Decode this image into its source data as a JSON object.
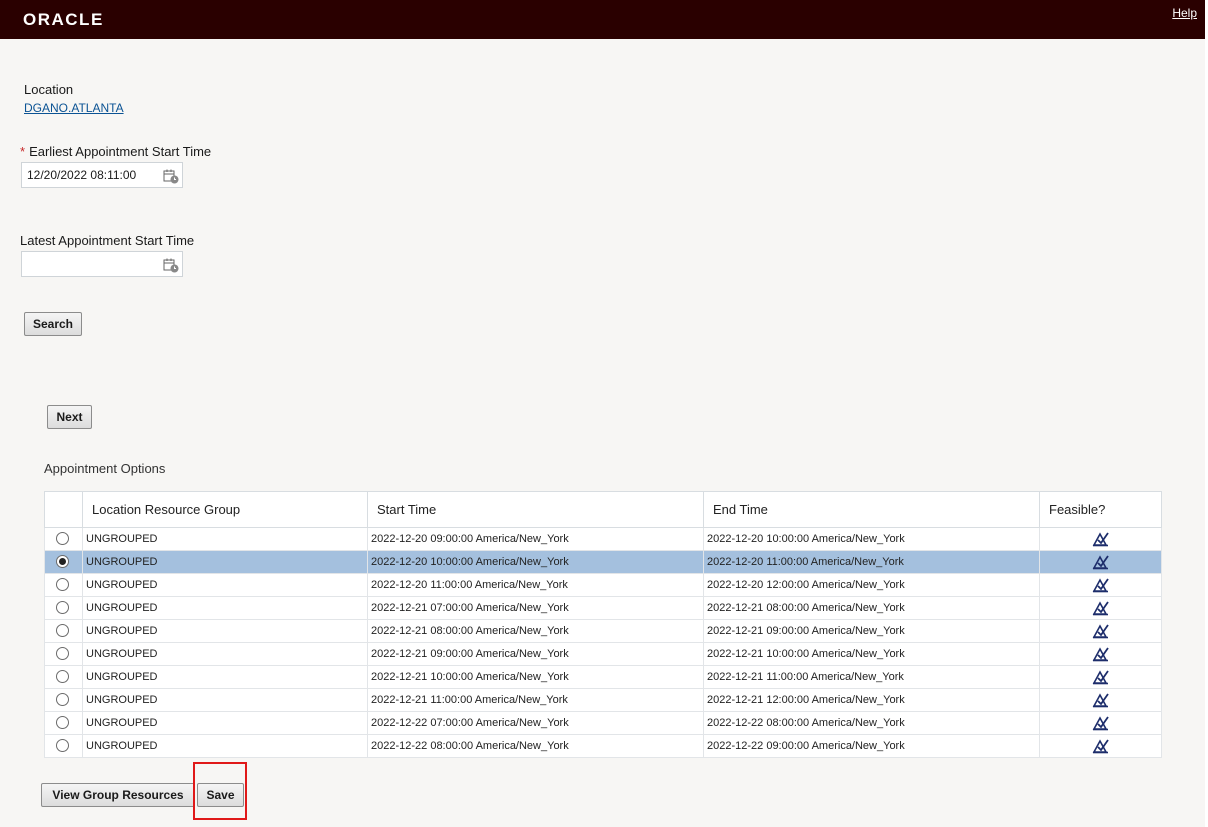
{
  "header": {
    "logo": "ORACLE",
    "help": "Help"
  },
  "form": {
    "location_label": "Location",
    "location_value": "DGANO.ATLANTA",
    "earliest_label": "Earliest Appointment Start Time",
    "earliest_required": "*",
    "earliest_value": "12/20/2022 08:11:00",
    "latest_label": "Latest Appointment Start Time",
    "latest_value": ""
  },
  "buttons": {
    "search": "Search",
    "next": "Next",
    "view_group_resources": "View Group Resources",
    "save": "Save"
  },
  "table": {
    "title": "Appointment Options",
    "columns": [
      "",
      "Location Resource Group",
      "Start Time",
      "End Time",
      "Feasible?"
    ],
    "rows": [
      {
        "group": "UNGROUPED",
        "start": "2022-12-20 09:00:00 America/New_York",
        "end": "2022-12-20 10:00:00 America/New_York",
        "selected": false
      },
      {
        "group": "UNGROUPED",
        "start": "2022-12-20 10:00:00 America/New_York",
        "end": "2022-12-20 11:00:00 America/New_York",
        "selected": true
      },
      {
        "group": "UNGROUPED",
        "start": "2022-12-20 11:00:00 America/New_York",
        "end": "2022-12-20 12:00:00 America/New_York",
        "selected": false
      },
      {
        "group": "UNGROUPED",
        "start": "2022-12-21 07:00:00 America/New_York",
        "end": "2022-12-21 08:00:00 America/New_York",
        "selected": false
      },
      {
        "group": "UNGROUPED",
        "start": "2022-12-21 08:00:00 America/New_York",
        "end": "2022-12-21 09:00:00 America/New_York",
        "selected": false
      },
      {
        "group": "UNGROUPED",
        "start": "2022-12-21 09:00:00 America/New_York",
        "end": "2022-12-21 10:00:00 America/New_York",
        "selected": false
      },
      {
        "group": "UNGROUPED",
        "start": "2022-12-21 10:00:00 America/New_York",
        "end": "2022-12-21 11:00:00 America/New_York",
        "selected": false
      },
      {
        "group": "UNGROUPED",
        "start": "2022-12-21 11:00:00 America/New_York",
        "end": "2022-12-21 12:00:00 America/New_York",
        "selected": false
      },
      {
        "group": "UNGROUPED",
        "start": "2022-12-22 07:00:00 America/New_York",
        "end": "2022-12-22 08:00:00 America/New_York",
        "selected": false
      },
      {
        "group": "UNGROUPED",
        "start": "2022-12-22 08:00:00 America/New_York",
        "end": "2022-12-22 09:00:00 America/New_York",
        "selected": false
      }
    ]
  },
  "icons": {
    "calendar": "calendar-clock-icon",
    "feasible": "feasible-check-icon"
  },
  "colors": {
    "header_bg": "#2a0000",
    "selected_row": "#a4c0de",
    "highlight": "#e01919",
    "link": "#0b5394"
  }
}
